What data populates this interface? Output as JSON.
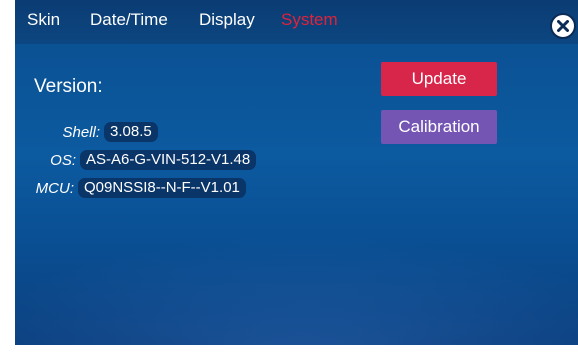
{
  "tabs": [
    {
      "label": "Skin",
      "active": false
    },
    {
      "label": "Date/Time",
      "active": false
    },
    {
      "label": "Display",
      "active": false
    },
    {
      "label": "System",
      "active": true
    }
  ],
  "close_icon": "close-x-icon",
  "version": {
    "title": "Version:",
    "items": [
      {
        "label": "Shell:",
        "value": "3.08.5"
      },
      {
        "label": "OS:",
        "value": "AS-A6-G-VIN-512-V1.48"
      },
      {
        "label": "MCU:",
        "value": "Q09NSSI8--N-F--V1.01"
      }
    ]
  },
  "buttons": {
    "update": "Update",
    "calibration": "Calibration"
  },
  "colors": {
    "background": "#0c5aa0",
    "active_tab": "#e0223c",
    "update_button": "#d8254a",
    "calibration_button": "#7455b3"
  }
}
